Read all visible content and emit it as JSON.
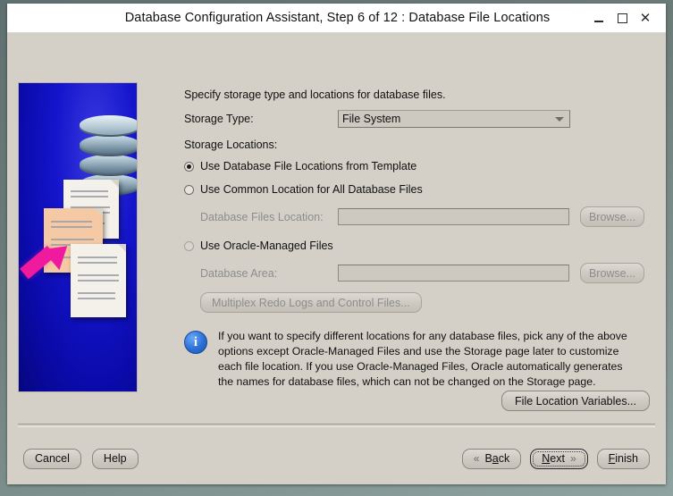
{
  "window": {
    "title": "Database Configuration Assistant, Step 6 of 12 : Database File Locations",
    "minimize_label": "Minimize",
    "maximize_label": "Maximize",
    "close_label": "Close",
    "close_glyph": "✕"
  },
  "colors": {
    "window_background": "#d4d0c8",
    "titlebar_background": "#ffffff",
    "desktop_background": "#6d7d7a",
    "illustration_background": "#0d0db8",
    "arrow_accent": "#f01a9e",
    "info_icon": "#2a6fd6",
    "disabled_text": "#8d8d8d",
    "text": "#101010"
  },
  "illustration": {
    "name": "database-files-illustration",
    "database_icon": "database-cylinder-icon",
    "arrow_icon": "magenta-arrow-icon",
    "pages_icon": "document-pages-icon"
  },
  "main": {
    "intro": "Specify storage type and locations for database files.",
    "storage_type_label": "Storage Type:",
    "storage_type_value": "File System",
    "storage_type_options": [
      "File System"
    ],
    "storage_locations_label": "Storage Locations:",
    "options": [
      {
        "label": "Use Database File Locations from Template",
        "selected": true,
        "disabled": false
      },
      {
        "label": "Use Common Location for All Database Files",
        "selected": false,
        "disabled": false
      },
      {
        "label": "Use Oracle-Managed Files",
        "selected": false,
        "disabled": true
      }
    ],
    "database_files_location_label": "Database Files Location:",
    "database_files_location_value": "",
    "database_area_label": "Database Area:",
    "database_area_value": "",
    "browse_label": "Browse...",
    "multiplex_label": "Multiplex Redo Logs and Control Files...",
    "info_text": "If you want to specify different locations for any database files, pick any of the above options except Oracle-Managed Files and use the Storage page later to customize each file location. If you use Oracle-Managed Files, Oracle automatically generates the names for database files, which can not be changed on the Storage page.",
    "info_icon_glyph": "i",
    "file_location_variables_label": "File Location Variables..."
  },
  "footer": {
    "cancel_label": "Cancel",
    "help_label": "Help",
    "back_label_pre": "B",
    "back_label_mnemonic": "a",
    "back_label_post": "ck",
    "back_label": "Back",
    "next_label": "Next",
    "next_label_pre": "",
    "next_label_mnemonic": "N",
    "next_label_post": "ext",
    "finish_label": "Finish",
    "finish_label_mnemonic": "F",
    "finish_label_post": "inish",
    "back_chevron": "«",
    "next_chevron": "»"
  }
}
